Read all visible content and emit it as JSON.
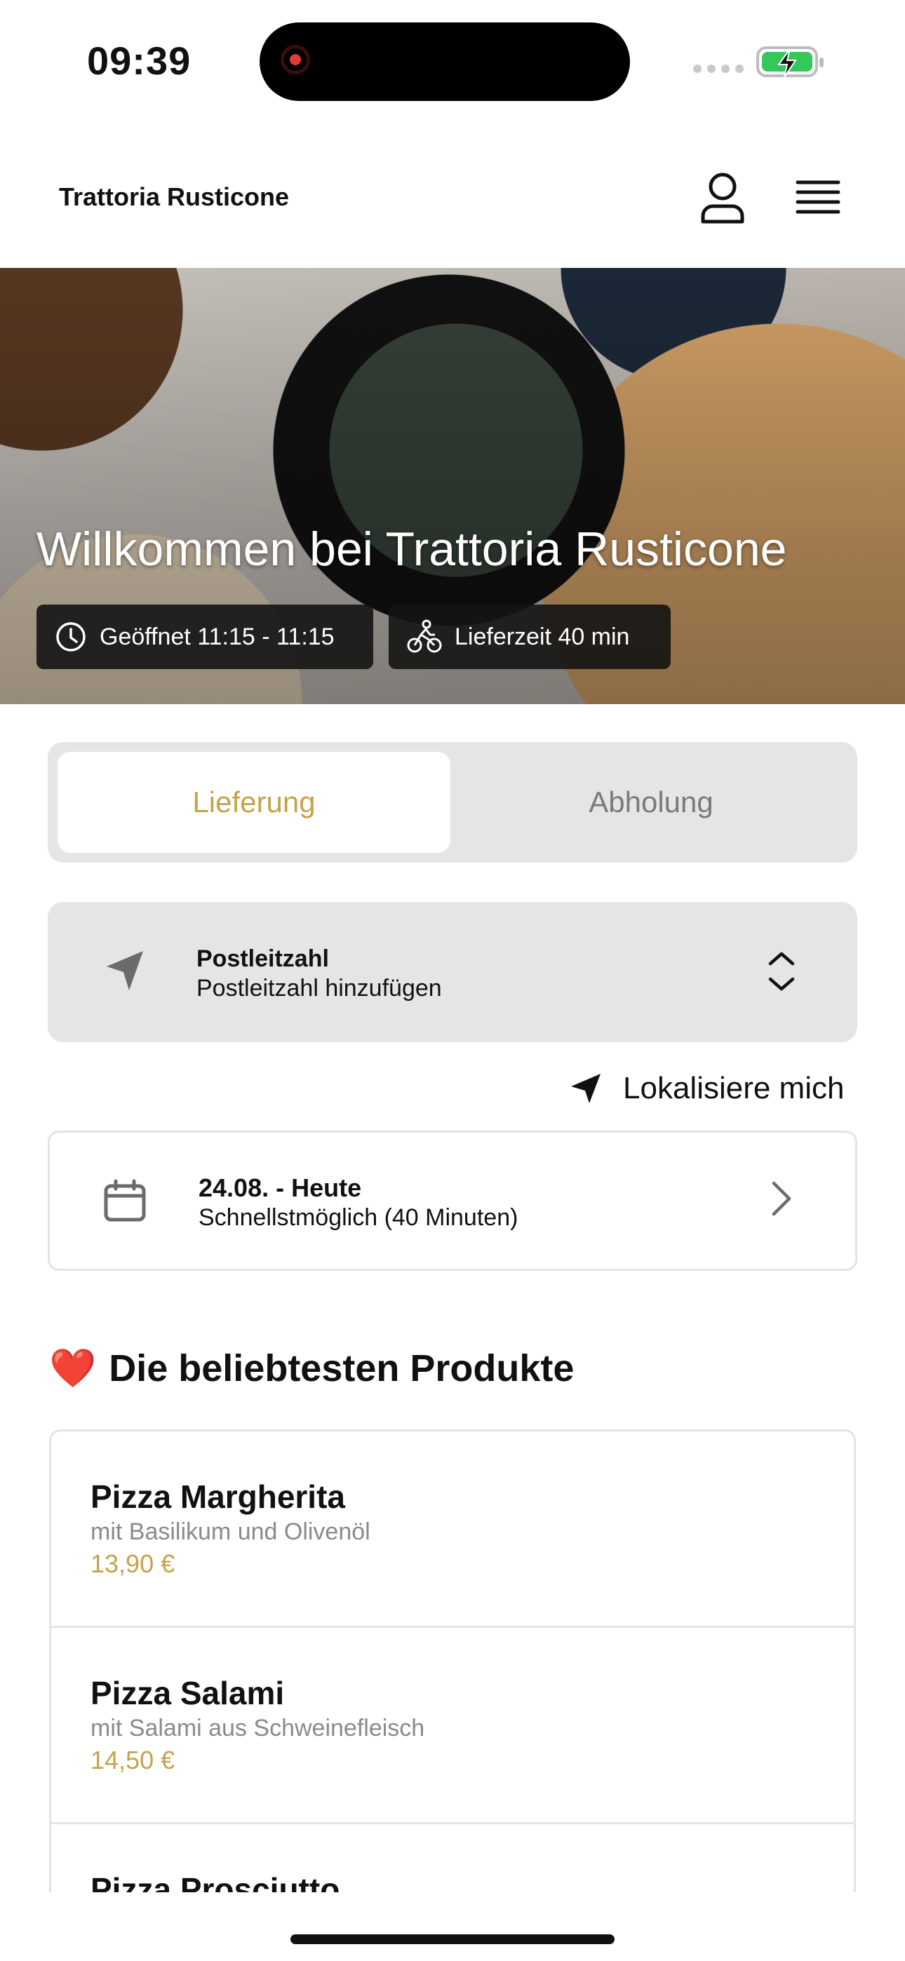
{
  "status_bar": {
    "time": "09:39"
  },
  "header": {
    "brand": "Trattoria Rusticone"
  },
  "hero": {
    "title": "Willkommen bei Trattoria Rusticone",
    "open_hours": "Geöffnet 11:15 - 11:15",
    "delivery_time": "Lieferzeit 40 min"
  },
  "order_mode": {
    "delivery": "Lieferung",
    "pickup": "Abholung",
    "selected": "Lieferung"
  },
  "postcode": {
    "title": "Postleitzahl",
    "placeholder": "Postleitzahl hinzufügen"
  },
  "locate": {
    "label": "Lokalisiere mich"
  },
  "schedule": {
    "date": "24.08. - Heute",
    "time": "Schnellstmöglich (40 Minuten)"
  },
  "popular": {
    "emoji": "❤️",
    "title": "Die beliebtesten Produkte",
    "products": [
      {
        "name": "Pizza Margherita",
        "description": "mit Basilikum und Olivenöl",
        "price": "13,90 €"
      },
      {
        "name": "Pizza Salami",
        "description": "mit Salami aus Schweinefleisch",
        "price": "14,50 €"
      },
      {
        "name": "Pizza Prosciutto",
        "description": "",
        "price": ""
      }
    ]
  },
  "colors": {
    "accent": "#c4a34a",
    "segment_bg": "#e5e5e5",
    "chip_bg": "#141414"
  }
}
